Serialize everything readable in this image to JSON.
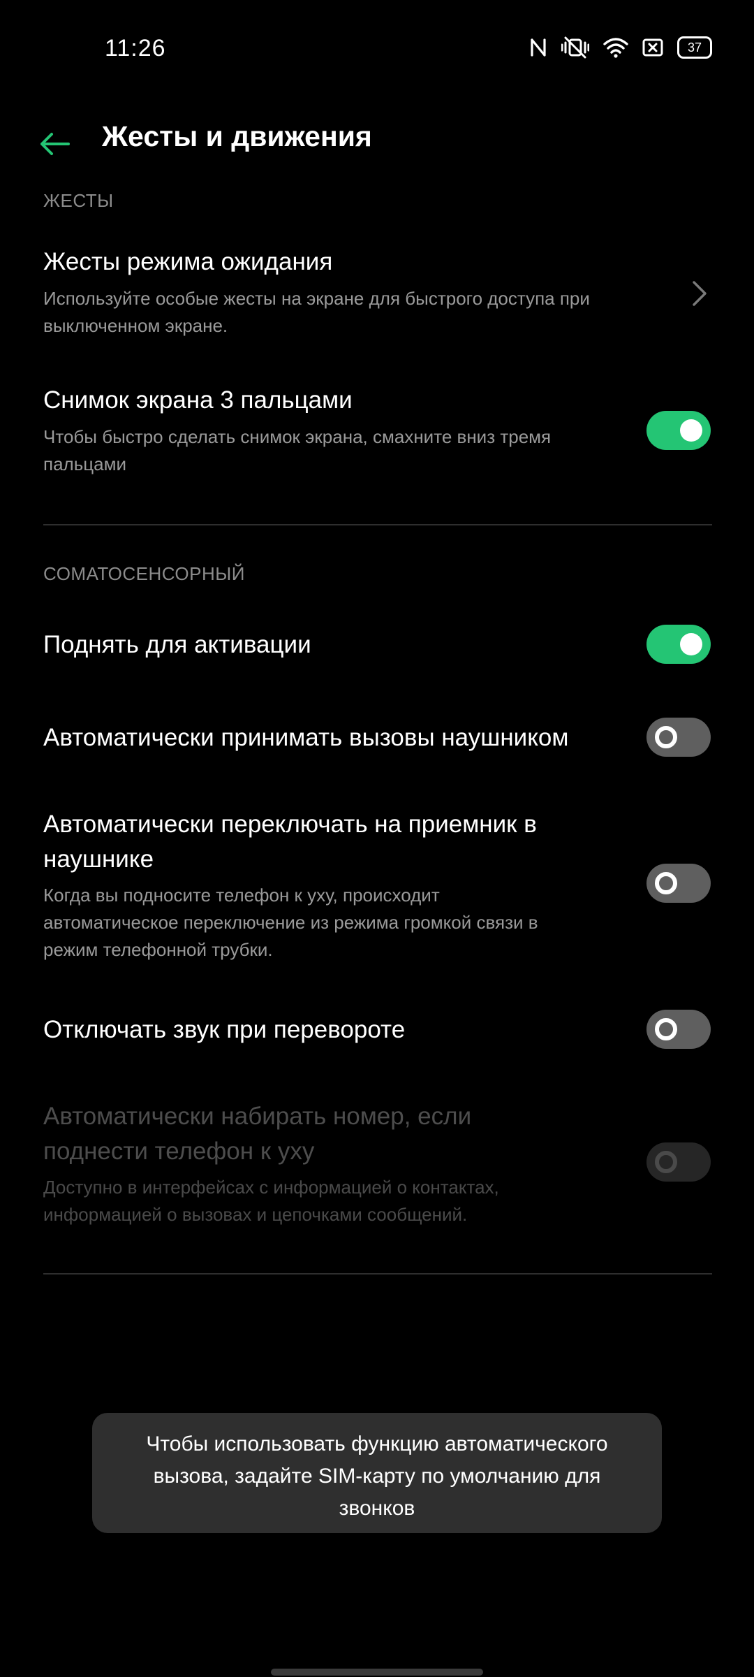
{
  "status_bar": {
    "time": "11:26",
    "battery": "37",
    "icons": [
      "nfc-icon",
      "vibrate-off-icon",
      "wifi-icon",
      "sim-icon",
      "battery-icon"
    ]
  },
  "header": {
    "title": "Жесты и движения",
    "back_icon": "arrow-left-icon"
  },
  "sections": {
    "gestures": {
      "label": "ЖЕСТЫ",
      "items": [
        {
          "title": "Жесты режима ожидания",
          "subtitle_line1": "Используйте особые жесты на экране для быстрого доступа при",
          "subtitle_line2": "выключенном экране."
        },
        {
          "title": "Снимок экрана 3 пальцами",
          "subtitle_line1": "Чтобы быстро сделать снимок экрана, смахните вниз тремя",
          "subtitle_line2": "пальцами",
          "enabled": true
        }
      ]
    },
    "motion": {
      "label": "СОМАТОСЕНСОРНЫЙ",
      "items": [
        {
          "title": "Поднять для активации",
          "enabled": true
        },
        {
          "title": "Автоматически принимать вызовы наушником",
          "enabled": false
        },
        {
          "title_line1": "Автоматически переключать на приемник в",
          "title_line2": "наушнике",
          "subtitle_line1": "Когда вы подносите телефон к уху, происходит",
          "subtitle_line2": "автоматическое переключение из режима громкой связи в",
          "subtitle_line3": "режим телефонной трубки.",
          "enabled": false
        },
        {
          "title": "Отключать звук при перевороте",
          "enabled": false
        },
        {
          "title_line1": "Автоматически набирать номер, если",
          "title_line2": "поднести телефон к уху",
          "subtitle_line1": "Доступно в интерфейсах с информацией о контактах,",
          "subtitle_line2": "информацией о вызовах и цепочками сообщений.",
          "enabled": false,
          "disabled": true
        }
      ]
    }
  },
  "toast": {
    "line1": "Чтобы использовать функцию автоматического",
    "line2": "вызова, задайте SIM-карту по умолчанию для",
    "line3": "звонков"
  },
  "colors": {
    "accent": "#24c574",
    "background": "#000000",
    "toggle_off": "#5f5f5f"
  }
}
